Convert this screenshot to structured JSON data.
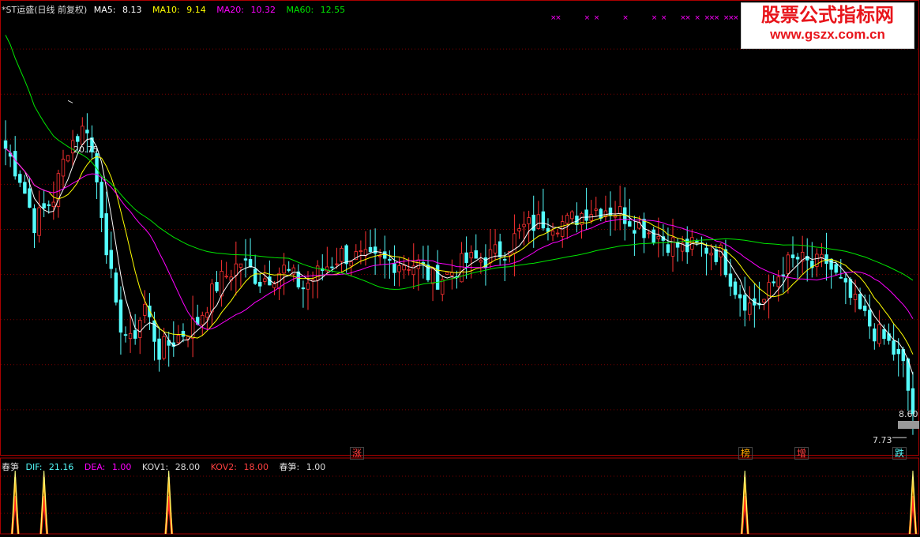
{
  "legend": {
    "name": "*ST运盛(日线 前复权)",
    "ma5_label": "MA5:",
    "ma5_value": "8.13",
    "ma10_label": "MA10:",
    "ma10_value": "9.14",
    "ma20_label": "MA20:",
    "ma20_value": "10.32",
    "ma60_label": "MA60:",
    "ma60_value": "12.55"
  },
  "indicator_legend": {
    "name": "春笋",
    "dif_label": "DIF:",
    "dif_value": "21.16",
    "dea_label": "DEA:",
    "dea_value": "1.00",
    "kov1_label": "KOV1:",
    "kov1_value": "28.00",
    "kov2_label": "KOV2:",
    "kov2_value": "18.00",
    "cs_label": "春笋:",
    "cs_value": "1.00"
  },
  "watermark": {
    "title": "股票公式指标网",
    "url": "www.gszx.com.cn"
  },
  "high_label": "20.75",
  "last_label": "8.60",
  "low_label": "7.73",
  "tags": {
    "zhang": "涨",
    "bang": "榜",
    "zeng": "增",
    "die": "跌"
  },
  "colors": {
    "up": "#ff3232",
    "down": "#54fcfc",
    "ma5": "#ffffff",
    "ma10": "#ffff00",
    "ma20": "#ff00ff",
    "ma60": "#00e600",
    "grid": "#7a0000",
    "axis": "#aa0000",
    "marker": "#ff00ff"
  },
  "chart_data": {
    "type": "candlestick",
    "bars": 190,
    "ylim": [
      7.0,
      24.5
    ],
    "price_path": [
      [
        0,
        18.9
      ],
      [
        3,
        17.8
      ],
      [
        6,
        16.0
      ],
      [
        10,
        17.0
      ],
      [
        13,
        19.0
      ],
      [
        17,
        19.8
      ],
      [
        20,
        16.5
      ],
      [
        23,
        12.5
      ],
      [
        26,
        11.3
      ],
      [
        29,
        12.8
      ],
      [
        32,
        11.0
      ],
      [
        36,
        11.6
      ],
      [
        40,
        12.2
      ],
      [
        44,
        13.6
      ],
      [
        49,
        14.5
      ],
      [
        53,
        13.8
      ],
      [
        58,
        14.2
      ],
      [
        62,
        13.5
      ],
      [
        66,
        14.2
      ],
      [
        70,
        14.8
      ],
      [
        76,
        14.5
      ],
      [
        82,
        14.5
      ],
      [
        86,
        14.4
      ],
      [
        89,
        13.8
      ],
      [
        92,
        14.0
      ],
      [
        96,
        14.5
      ],
      [
        100,
        14.6
      ],
      [
        104,
        15.0
      ],
      [
        108,
        15.8
      ],
      [
        112,
        16.1
      ],
      [
        117,
        16.0
      ],
      [
        121,
        16.5
      ],
      [
        125,
        16.6
      ],
      [
        129,
        16.3
      ],
      [
        133,
        15.8
      ],
      [
        137,
        15.4
      ],
      [
        141,
        15.0
      ],
      [
        145,
        15.1
      ],
      [
        149,
        14.8
      ],
      [
        152,
        13.5
      ],
      [
        155,
        12.8
      ],
      [
        158,
        13.0
      ],
      [
        162,
        14.3
      ],
      [
        165,
        14.6
      ],
      [
        168,
        14.3
      ],
      [
        171,
        14.5
      ],
      [
        174,
        13.6
      ],
      [
        177,
        12.8
      ],
      [
        181,
        11.8
      ],
      [
        184,
        11.3
      ],
      [
        187,
        10.4
      ],
      [
        189,
        8.6
      ]
    ],
    "high": 20.75,
    "last": 8.6,
    "low": 7.73,
    "ma5": "8.13",
    "ma10": "9.14",
    "ma20": "10.32",
    "ma60": "12.55",
    "signal_markers_x": [
      114,
      115,
      121,
      123,
      129,
      135,
      137,
      141,
      142,
      144,
      146,
      147,
      148,
      150,
      151,
      152
    ],
    "spikes_x": [
      2,
      8,
      34,
      154,
      189
    ],
    "indicator_ylim": [
      0,
      1.2
    ]
  }
}
